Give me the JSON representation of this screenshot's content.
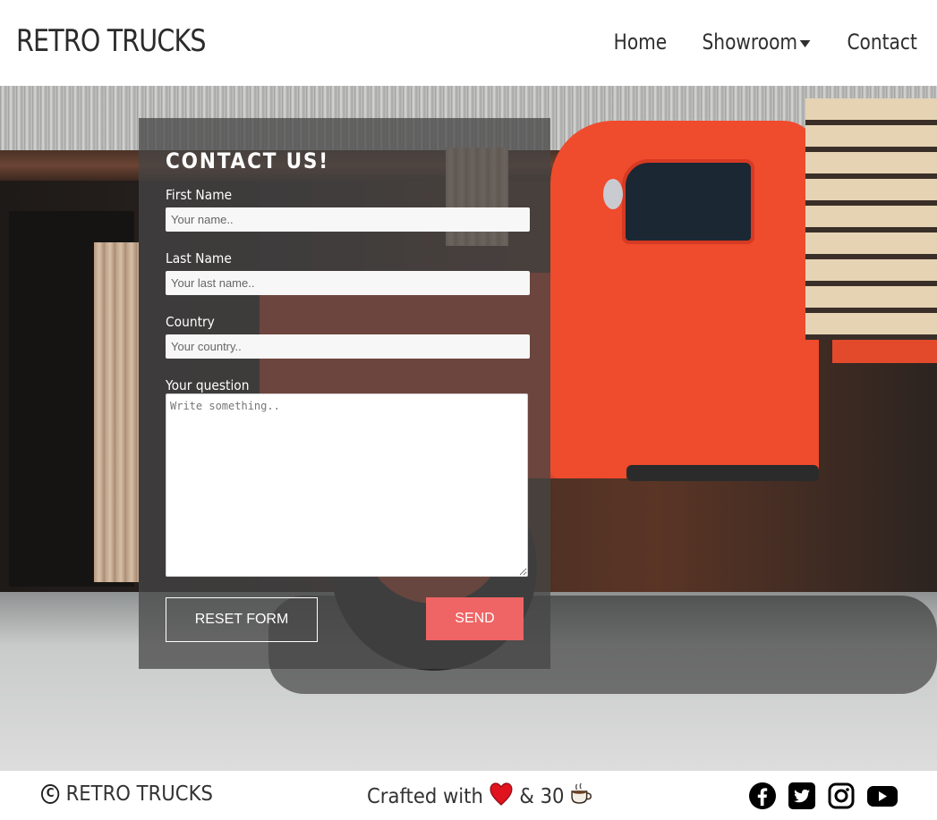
{
  "header": {
    "brand": "RETRO TRUCKS",
    "nav": [
      {
        "label": "Home",
        "icon": null
      },
      {
        "label": "Showroom",
        "icon": "caret-down-icon"
      },
      {
        "label": "Contact",
        "icon": null
      }
    ]
  },
  "form": {
    "title": "CONTACT US!",
    "first_name_label": "First Name",
    "first_name_placeholder": "Your name..",
    "last_name_label": "Last Name",
    "last_name_placeholder": "Your last name..",
    "country_label": "Country",
    "country_placeholder": "Your country..",
    "question_label": "Your question",
    "question_placeholder": "Write something..",
    "reset_label": "RESET FORM",
    "send_label": "SEND"
  },
  "footer": {
    "copyright": "RETRO TRUCKS",
    "crafted_prefix": "Crafted with",
    "crafted_suffix": "& 30",
    "socials": [
      "facebook-icon",
      "twitter-icon",
      "instagram-icon",
      "youtube-icon"
    ]
  },
  "colors": {
    "accent": "#ef6464",
    "panel": "rgba(70,70,70,0.75)"
  }
}
